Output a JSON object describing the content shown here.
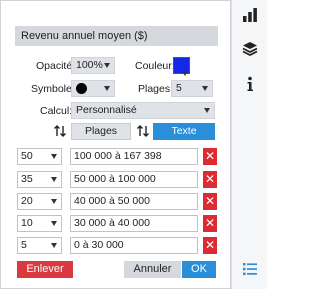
{
  "panel": {
    "title": "Revenu annuel moyen ($)",
    "opacity_label": "Opacité:",
    "opacity_value": "100%",
    "color_label": "Couleur:",
    "color_value": "#1727e6",
    "symbol_label": "Symbole:",
    "ranges_label": "Plages:",
    "ranges_value": "5",
    "calc_label": "Calcul:",
    "calc_value": "Personnalisé",
    "tab_plages": "Plages",
    "tab_texte": "Texte",
    "rows": [
      {
        "value": "50",
        "range": "100 000 à 167 398"
      },
      {
        "value": "35",
        "range": "50 000 à 100 000"
      },
      {
        "value": "20",
        "range": "40 000 à 50 000"
      },
      {
        "value": "10",
        "range": "30 000 à 40 000"
      },
      {
        "value": "5",
        "range": "0 à 30 000"
      }
    ],
    "delete_glyph": "✕",
    "remove_button": "Enlever",
    "cancel_button": "Annuler",
    "ok_button": "OK"
  },
  "sidebar": {
    "icons": [
      "bar-chart-icon",
      "layers-icon",
      "info-icon",
      "list-icon"
    ],
    "active_color": "#2a8fd8"
  }
}
